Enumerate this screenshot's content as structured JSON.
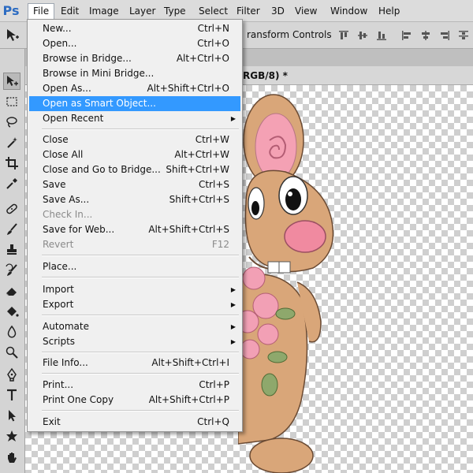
{
  "app": {
    "logo": "Ps"
  },
  "menubar": {
    "items": [
      "File",
      "Edit",
      "Image",
      "Layer",
      "Type",
      "Select",
      "Filter",
      "3D",
      "View",
      "Window",
      "Help"
    ],
    "active": "File"
  },
  "options_bar": {
    "label": "ransform Controls"
  },
  "document": {
    "tab_title": "RGB/8) *"
  },
  "icons": {
    "tools": [
      "move-tool-icon",
      "marquee-tool-icon",
      "lasso-tool-icon",
      "magic-wand-tool-icon",
      "crop-tool-icon",
      "eyedropper-tool-icon",
      "healing-brush-tool-icon",
      "brush-tool-icon",
      "clone-stamp-tool-icon",
      "history-brush-tool-icon",
      "eraser-tool-icon",
      "paint-bucket-tool-icon",
      "blur-tool-icon",
      "dodge-tool-icon",
      "pen-tool-icon",
      "type-tool-icon",
      "path-selection-tool-icon",
      "custom-shape-tool-icon",
      "hand-tool-icon"
    ]
  },
  "file_menu": {
    "items": [
      {
        "label": "New...",
        "shortcut": "Ctrl+N"
      },
      {
        "label": "Open...",
        "shortcut": "Ctrl+O"
      },
      {
        "label": "Browse in Bridge...",
        "shortcut": "Alt+Ctrl+O"
      },
      {
        "label": "Browse in Mini Bridge...",
        "shortcut": ""
      },
      {
        "label": "Open As...",
        "shortcut": "Alt+Shift+Ctrl+O"
      },
      {
        "label": "Open as Smart Object...",
        "shortcut": "",
        "highlighted": true
      },
      {
        "label": "Open Recent",
        "shortcut": "",
        "submenu": true
      },
      {
        "label": "Close",
        "shortcut": "Ctrl+W"
      },
      {
        "label": "Close All",
        "shortcut": "Alt+Ctrl+W"
      },
      {
        "label": "Close and Go to Bridge...",
        "shortcut": "Shift+Ctrl+W"
      },
      {
        "label": "Save",
        "shortcut": "Ctrl+S"
      },
      {
        "label": "Save As...",
        "shortcut": "Shift+Ctrl+S"
      },
      {
        "label": "Check In...",
        "shortcut": "",
        "disabled": true
      },
      {
        "label": "Save for Web...",
        "shortcut": "Alt+Shift+Ctrl+S"
      },
      {
        "label": "Revert",
        "shortcut": "F12",
        "disabled": true
      },
      {
        "label": "Place...",
        "shortcut": ""
      },
      {
        "label": "Import",
        "shortcut": "",
        "submenu": true
      },
      {
        "label": "Export",
        "shortcut": "",
        "submenu": true
      },
      {
        "label": "Automate",
        "shortcut": "",
        "submenu": true
      },
      {
        "label": "Scripts",
        "shortcut": "",
        "submenu": true
      },
      {
        "label": "File Info...",
        "shortcut": "Alt+Shift+Ctrl+I"
      },
      {
        "label": "Print...",
        "shortcut": "Ctrl+P"
      },
      {
        "label": "Print One Copy",
        "shortcut": "Alt+Shift+Ctrl+P"
      },
      {
        "label": "Exit",
        "shortcut": "Ctrl+Q"
      }
    ]
  },
  "colors": {
    "highlight": "#3399ff",
    "brand": "#2d6cc2"
  }
}
